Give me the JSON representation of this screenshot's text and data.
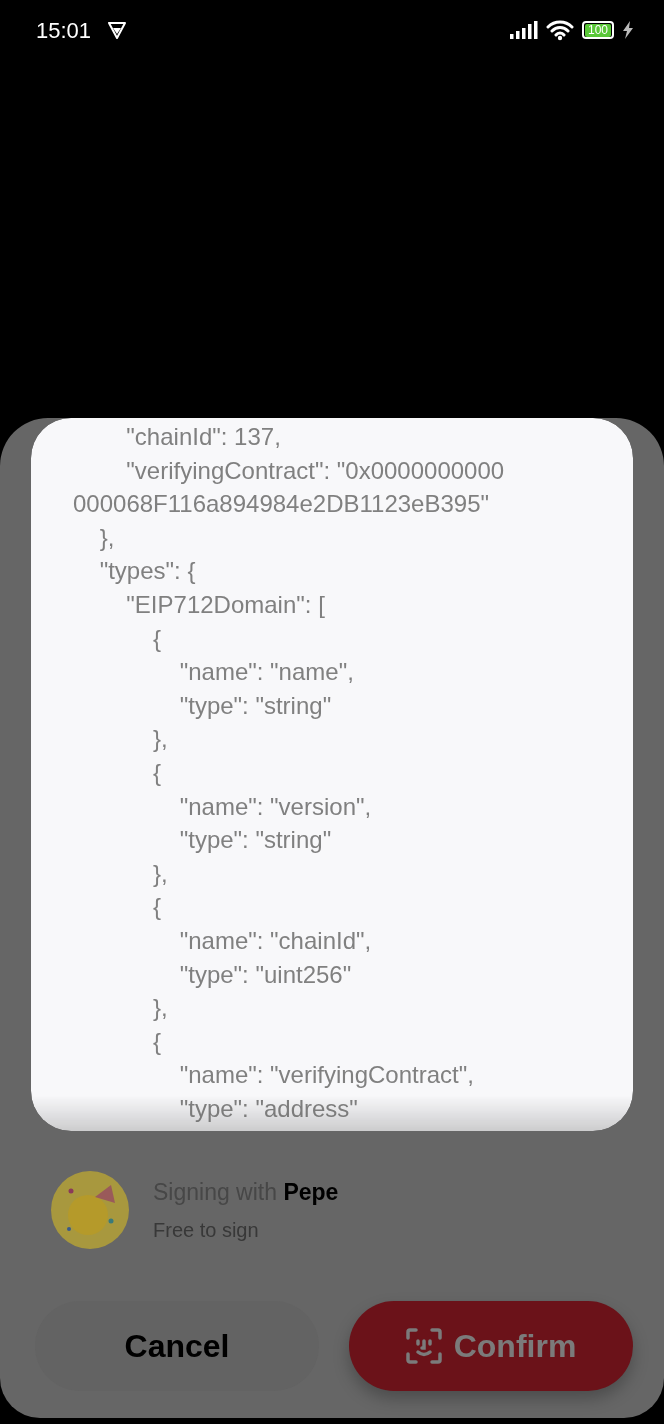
{
  "status_bar": {
    "time": "15:01",
    "battery": "100"
  },
  "message": {
    "lines": [
      "        \"chainId\": 137,",
      "        \"verifyingContract\": \"0x0000000000",
      "000068F116a894984e2DB1123eB395\"",
      "    },",
      "    \"types\": {",
      "        \"EIP712Domain\": [",
      "            {",
      "                \"name\": \"name\",",
      "                \"type\": \"string\"",
      "            },",
      "            {",
      "                \"name\": \"version\",",
      "                \"type\": \"string\"",
      "            },",
      "            {",
      "                \"name\": \"chainId\",",
      "                \"type\": \"uint256\"",
      "            },",
      "            {",
      "                \"name\": \"verifyingContract\",",
      "                \"type\": \"address\""
    ]
  },
  "signer": {
    "title": "Signing with **Pepe**",
    "subtitle": "Free to sign"
  },
  "buttons": [
    {
      "kind": "cancel",
      "label": "Cancel"
    },
    {
      "kind": "confirm",
      "label": "Confirm"
    }
  ]
}
